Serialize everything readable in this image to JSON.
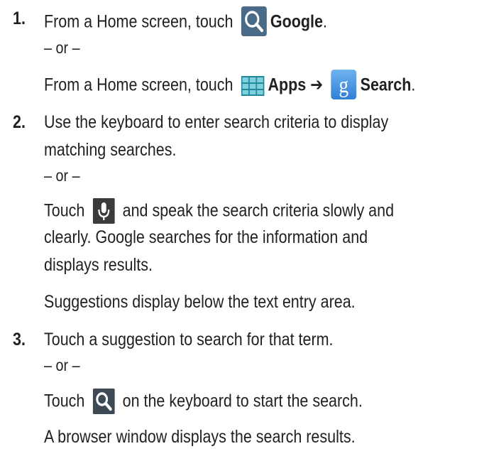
{
  "steps": [
    {
      "number": "1.",
      "lines": {
        "l1_text": "From a Home screen, touch",
        "l1_bold": "Google",
        "l1_end": ".",
        "or": "– or –",
        "l3_text": "From a Home screen, touch",
        "l3_apps": "Apps",
        "l3_arrow": "➔",
        "l3_search": "Search",
        "l3_end": "."
      }
    },
    {
      "number": "2.",
      "lines": {
        "l1": "Use the keyboard to enter search criteria to display",
        "l2": "matching searches.",
        "or": "– or –",
        "l4_pre": "Touch",
        "l4_post": "and speak the search criteria slowly and",
        "l5": "clearly. Google searches for the information and",
        "l6": "displays results.",
        "l7": "Suggestions display below the text entry area."
      }
    },
    {
      "number": "3.",
      "lines": {
        "l1": "Touch a suggestion to search for that term.",
        "or": "– or –",
        "l3_pre": "Touch",
        "l3_post": "on the keyboard to start the search.",
        "l4": "A browser window displays the search results."
      }
    }
  ],
  "icons": {
    "google_search": "google-search-icon",
    "apps": "apps-grid-icon",
    "search_app": "google-search-app-icon",
    "microphone": "microphone-icon",
    "keyboard_search": "keyboard-search-icon"
  }
}
